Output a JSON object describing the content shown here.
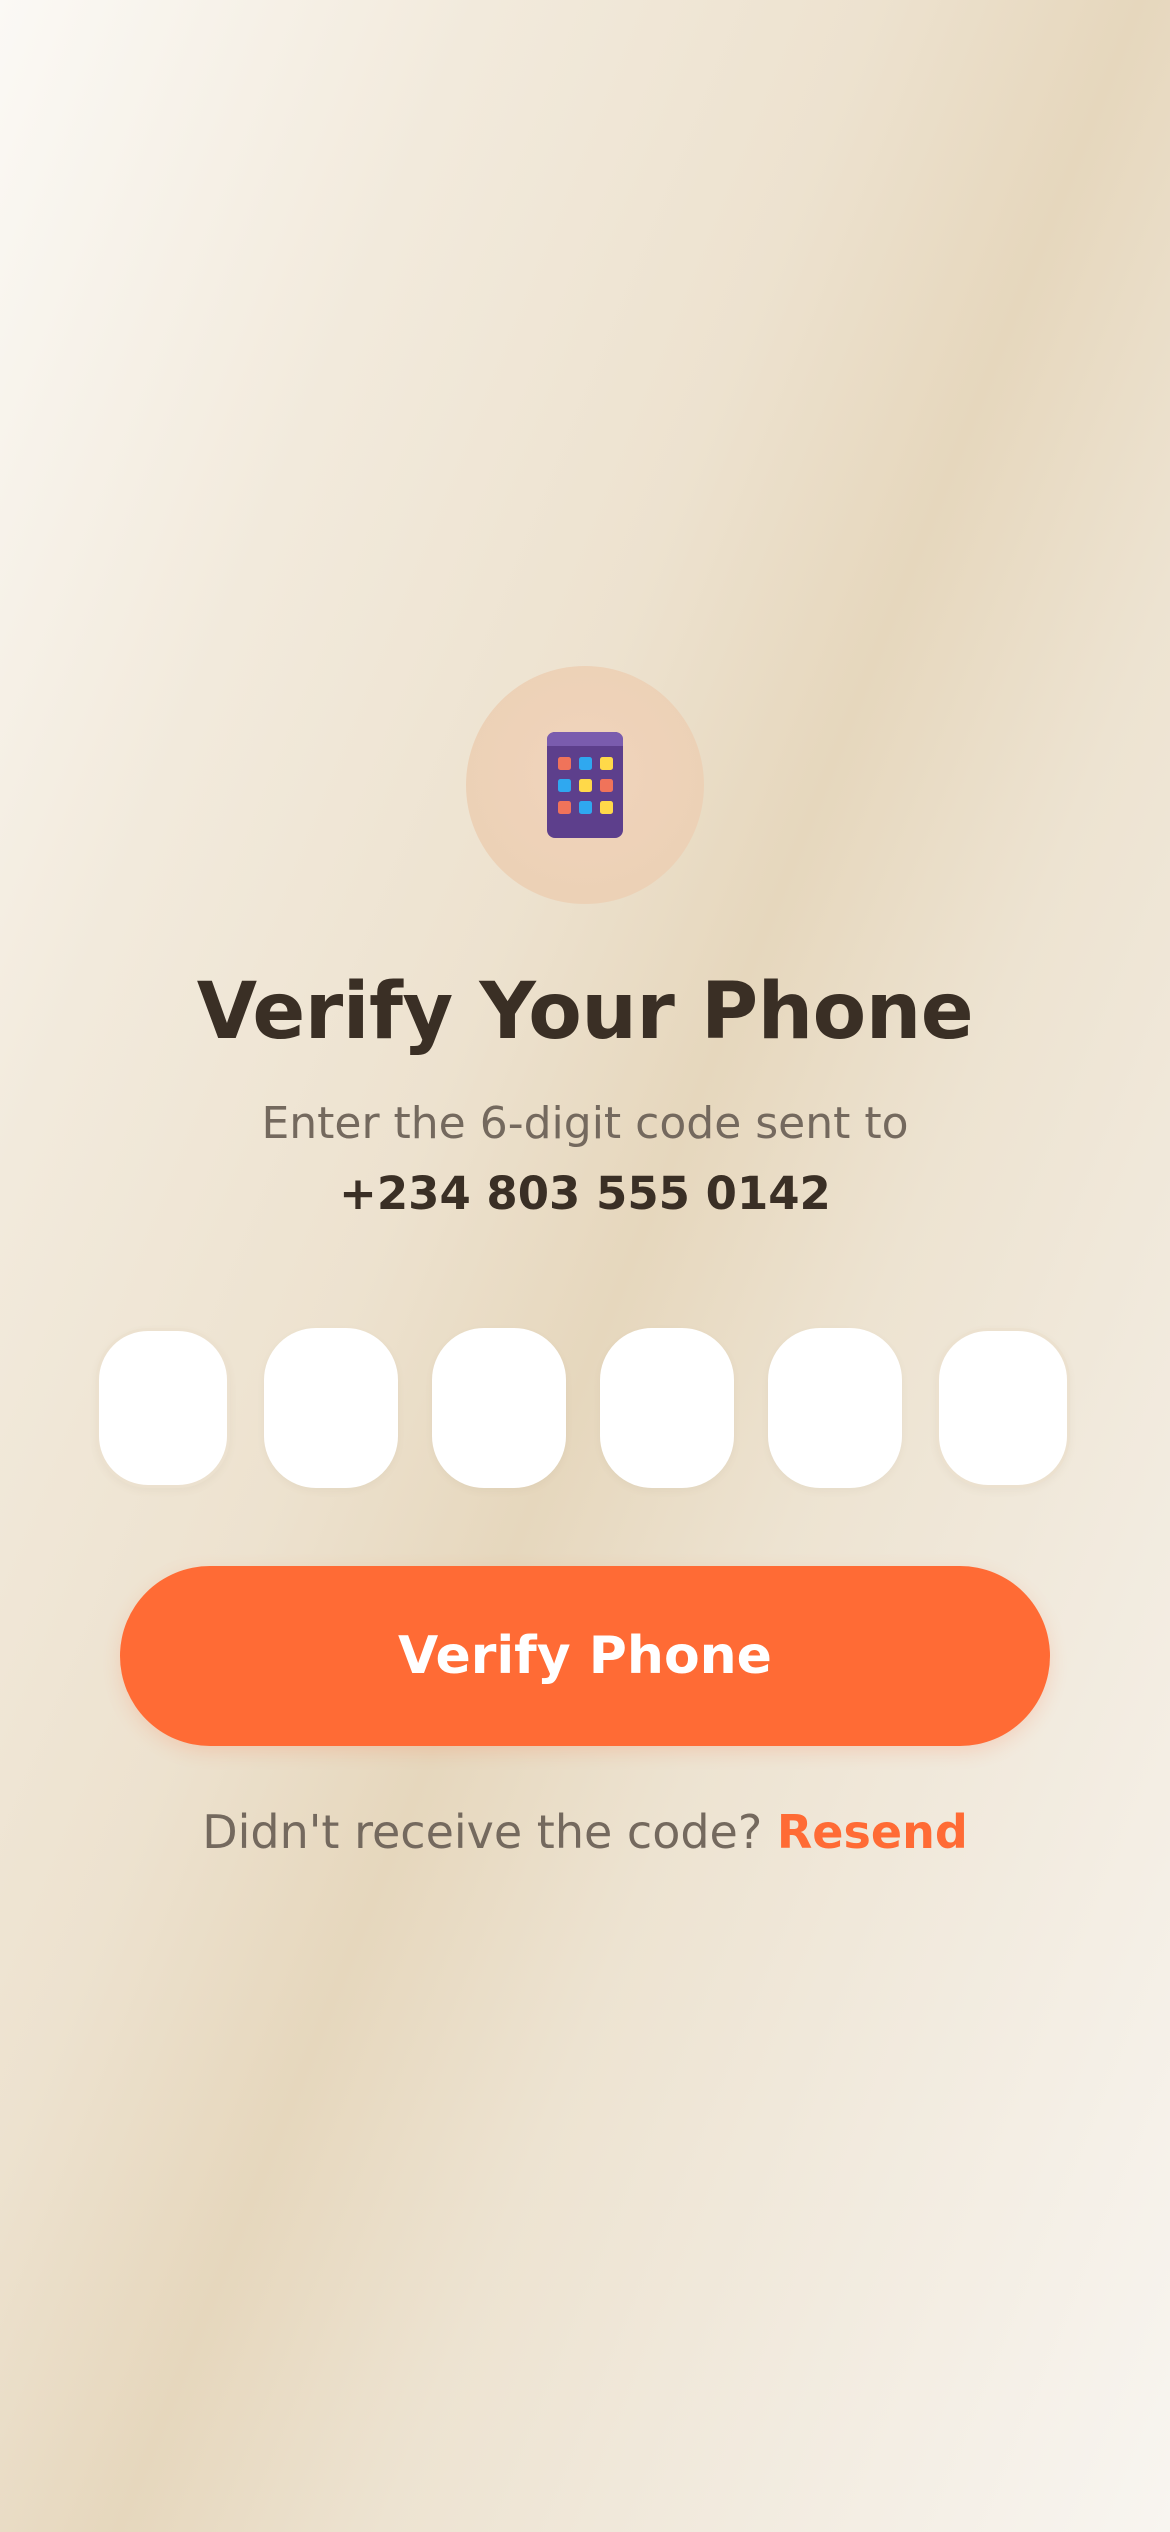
{
  "header": {
    "icon": "phone-app-grid-icon",
    "title": "Verify Your Phone",
    "subtitle": "Enter the 6-digit code sent to",
    "phone_number": "+234 803 555 0142"
  },
  "code_inputs": {
    "length": 6,
    "values": [
      "",
      "",
      "",
      "",
      "",
      ""
    ]
  },
  "verify_button": {
    "label": "Verify Phone"
  },
  "resend": {
    "prompt": "Didn't receive the code?",
    "link_label": "Resend"
  },
  "colors": {
    "accent": "#ff6b35",
    "title_text": "#3a2f25",
    "muted_text": "#74695e",
    "icon_circle": "#ecd1b6",
    "phone_body": "#6b4a9a",
    "input_background": "#ffffff"
  }
}
